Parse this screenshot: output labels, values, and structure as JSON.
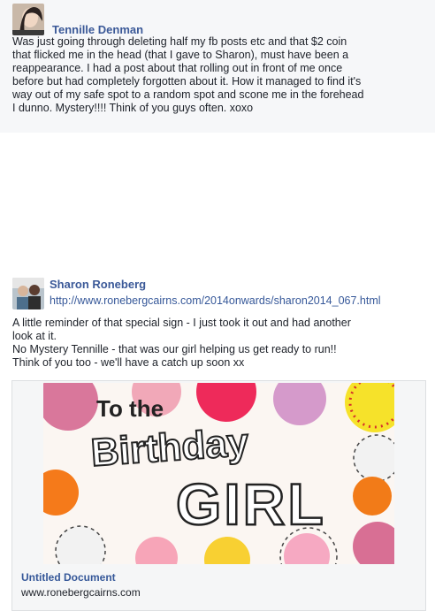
{
  "posts": [
    {
      "author": "Tennille Denman",
      "text": "Was just going through deleting half my fb posts etc and that $2 coin\nthat flicked me in the head (that I gave to Sharon), must have been a\nreappearance. I had a post about that rolling out in front of me once\nbefore but had completely forgotten about it. How it managed to find it's\nway out of my safe spot to a random spot and scone me in the forehead\nI dunno. Mystery!!!! Think of you guys often. xoxo"
    },
    {
      "author": "Sharon Roneberg",
      "link": "http://www.ronebergcairns.com/2014onwards/sharon2014_067.html",
      "text": "A little reminder of that special sign - I  just took it out and had another\nlook at it.\nNo Mystery Tennille - that was our girl helping us get ready to run!!\nThink of you too - we'll have a catch up soon xx",
      "card": {
        "image_text_line1": "To the",
        "image_text_line2": "Birthday",
        "image_text_line3": "GIRL",
        "title": "Untitled Document",
        "domain": "www.ronebergcairns.com"
      }
    }
  ],
  "colors": {
    "name_blue": "#3b5998",
    "link_blue": "#365899",
    "card_border": "#dddfe2"
  }
}
